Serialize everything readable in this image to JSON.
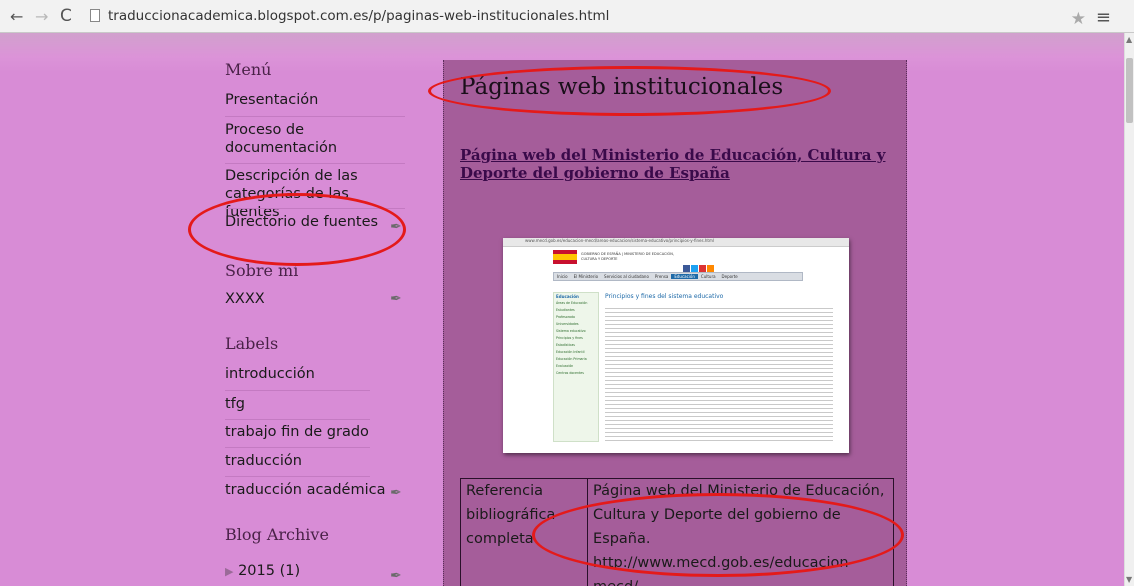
{
  "browser": {
    "url": "traduccionacademica.blogspot.com.es/p/paginas-web-institucionales.html",
    "back_icon": "←",
    "forward_icon": "→",
    "reload_icon": "C",
    "star_icon": "★",
    "menu_icon": "≡"
  },
  "sidebar": {
    "menu_title": "Menú",
    "menu_items": [
      "Presentación",
      "Proceso de documentación",
      "Descripción de las categorías de las fuentes",
      "Directorio de fuentes"
    ],
    "about_title": "Sobre mí",
    "about_text": "XXXX",
    "labels_title": "Labels",
    "labels": [
      "introducción",
      "tfg",
      "trabajo fin de grado",
      "traducción",
      "traducción académica"
    ],
    "archive_title": "Blog Archive",
    "archive_year": "2015",
    "archive_count": "(1)",
    "archive_toggle": "▶"
  },
  "post": {
    "title": "Páginas web institucionales",
    "link_text": "Página web del Ministerio de Educación, Cultura y Deporte del gobierno de España",
    "table": {
      "label": "Referencia bibliográfica completa",
      "value_line1": "Página web del Ministerio de Educación, Cultura y Deporte del gobierno de España.",
      "value_url": "http://www.mecd.gob.es/educacion-mecd/"
    }
  },
  "thumbnail": {
    "address": "www.mecd.gob.es/educacion-mecd/areas-educacion/sistema-educativo/principios-y-fines.html",
    "ministry": "GOBIERNO DE ESPAÑA | MINISTERIO DE EDUCACIÓN, CULTURA Y DEPORTE",
    "nav": [
      "Inicio",
      "El Ministerio",
      "Servicios al ciudadano",
      "Prensa",
      "Educación",
      "Cultura",
      "Deporte"
    ],
    "side_title": "Educación",
    "side_items": [
      "Áreas de Educación",
      "Estudiantes",
      "Profesorado",
      "Universidades",
      "Sistema educativo",
      "Principios y fines",
      "Estadísticas",
      "Educación Infantil",
      "Educación Primaria",
      "Evaluación",
      "Centros docentes"
    ],
    "content_title": "Principios y fines del sistema educativo"
  },
  "colors": {
    "page_bg": "#d88cd6",
    "post_bg": "#a55d9a",
    "annotation": "#e41a1a",
    "link": "#3a0a4a"
  }
}
